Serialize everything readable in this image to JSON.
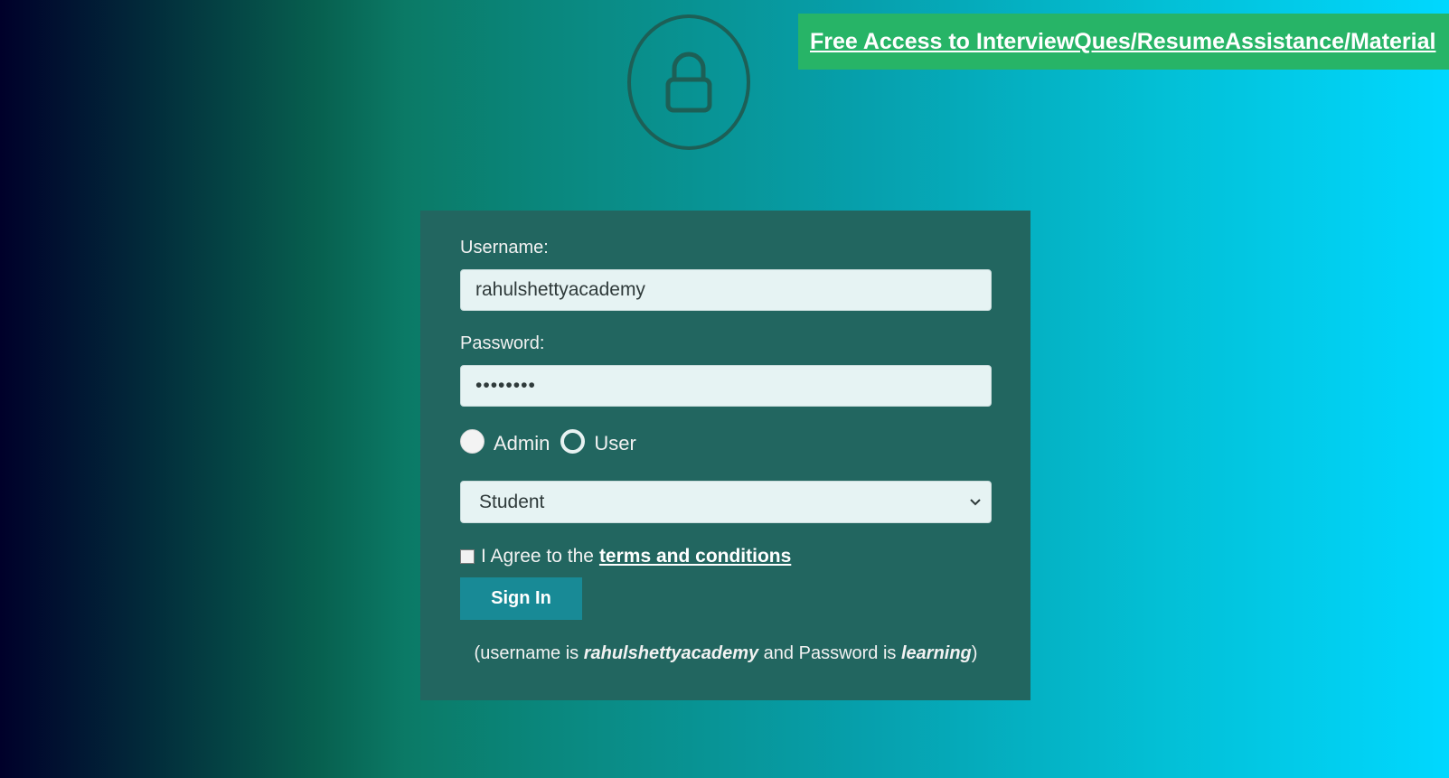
{
  "banner": {
    "link_text": "Free Access to InterviewQues/ResumeAssistance/Material"
  },
  "header": {
    "icon": "lock-icon"
  },
  "form": {
    "username_label": "Username:",
    "username_value": "rahulshettyacademy",
    "password_label": "Password:",
    "password_value": "learning",
    "radio_options": [
      {
        "label": "Admin",
        "selected": true
      },
      {
        "label": "User",
        "selected": false
      }
    ],
    "select_value": "Student",
    "terms_prefix": "I Agree to the",
    "terms_link": "terms and conditions",
    "terms_checked": false,
    "signin_label": "Sign In",
    "hint": {
      "p1": "(username is ",
      "username": "rahulshettyacademy",
      "p2": " and Password is ",
      "password": "learning",
      "p3": ")"
    }
  },
  "colors": {
    "banner": "#27b467",
    "card": "#226660",
    "signin": "#188a96",
    "lock": "#1d5f56"
  }
}
